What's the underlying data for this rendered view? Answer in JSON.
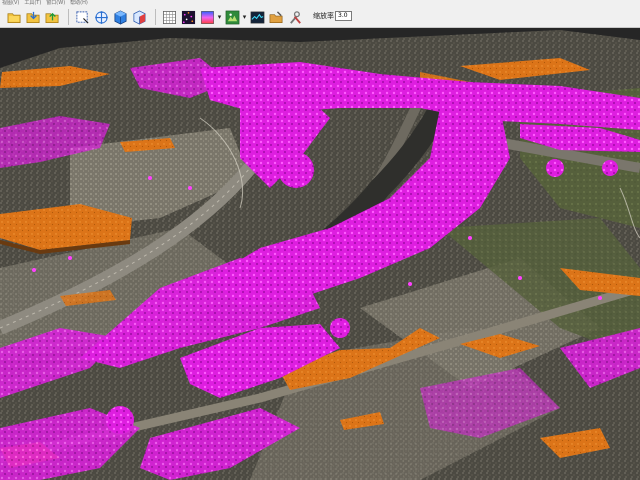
{
  "menu": [
    " 视图(V) ",
    " 工具(T) ",
    " 窗口(W) ",
    " 帮助(H) "
  ],
  "toolbar": {
    "buttons": [
      "open-folder-icon",
      "import-icon",
      "export-icon",
      "select-box-icon",
      "pan-move-icon",
      "cube-view-icon",
      "solid-view-icon",
      "grid-icon",
      "point-cloud-icon",
      "color-ramp-icon",
      "terrain-icon",
      "profile-icon",
      "folder-tools-icon",
      "settings-tools-icon"
    ]
  },
  "zoom": {
    "label": "缩放率",
    "value": "3.0"
  },
  "scene": {
    "colors": {
      "background": "#262626",
      "ground": "#4a4a44",
      "ground_light": "#6e6a60",
      "vegetation": "#e81ee8",
      "vegetation_dark": "#b010c0",
      "building": "#e0781c",
      "road": "#8a8a8a",
      "grass": "#5a6a3a"
    }
  }
}
